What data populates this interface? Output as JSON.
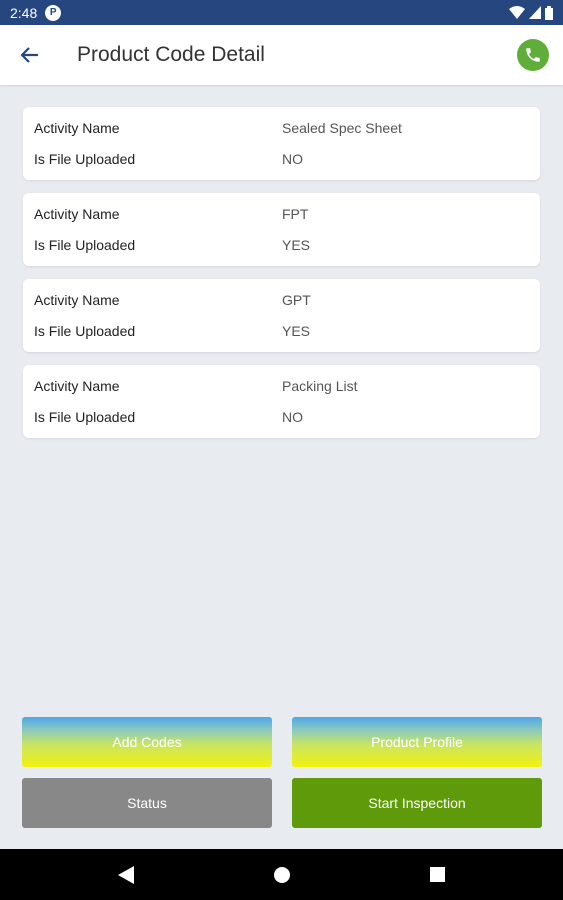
{
  "status_bar": {
    "time": "2:48",
    "notification_letter": "P"
  },
  "app_bar": {
    "title": "Product Code Detail"
  },
  "activities": [
    {
      "name_label": "Activity Name",
      "name": "Sealed Spec Sheet",
      "uploaded_label": "Is File Uploaded",
      "uploaded": "NO"
    },
    {
      "name_label": "Activity Name",
      "name": "FPT",
      "uploaded_label": "Is File Uploaded",
      "uploaded": "YES"
    },
    {
      "name_label": "Activity Name",
      "name": "GPT",
      "uploaded_label": "Is File Uploaded",
      "uploaded": "YES"
    },
    {
      "name_label": "Activity Name",
      "name": "Packing List",
      "uploaded_label": "Is File Uploaded",
      "uploaded": "NO"
    }
  ],
  "buttons": {
    "add_codes": "Add Codes",
    "product_profile": "Product Profile",
    "status": "Status",
    "start_inspection": "Start Inspection"
  },
  "colors": {
    "status_bar": "#26467f",
    "call_button": "#5fae3a",
    "start_inspection": "#5f9a0a",
    "status_button": "#888888"
  }
}
